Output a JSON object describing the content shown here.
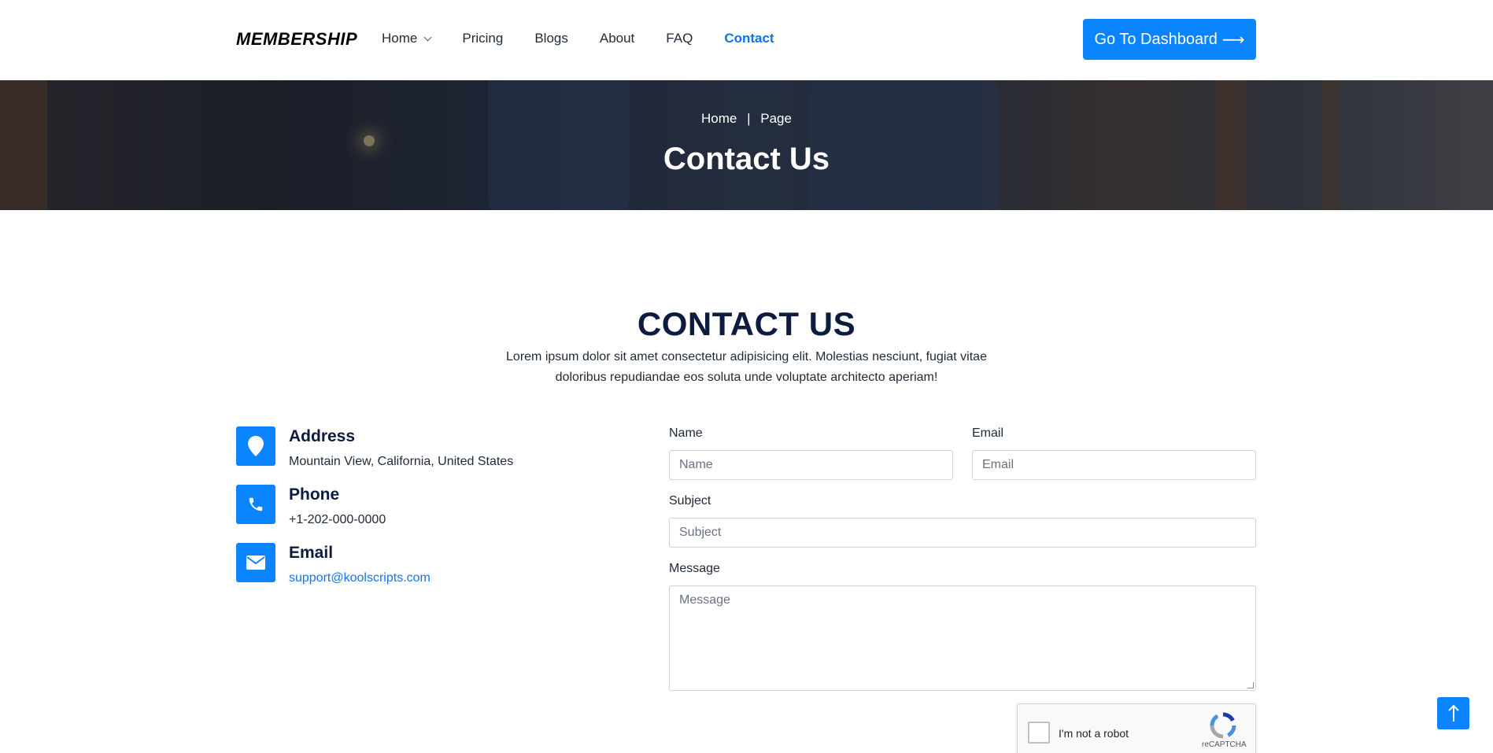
{
  "header": {
    "logo": "MEMBERSHIP",
    "nav": [
      {
        "label": "Home",
        "dropdown": true
      },
      {
        "label": "Pricing"
      },
      {
        "label": "Blogs"
      },
      {
        "label": "About"
      },
      {
        "label": "FAQ"
      },
      {
        "label": "Contact",
        "active": true
      }
    ],
    "dashboard_button": "Go To Dashboard",
    "dashboard_arrow": "⟶",
    "accent_color": "#0a84ff"
  },
  "hero": {
    "breadcrumb": [
      "Home",
      "Page"
    ],
    "breadcrumb_sep": "|",
    "title": "Contact Us"
  },
  "section": {
    "title": "CONTACT US",
    "description": "Lorem ipsum dolor sit amet consectetur adipisicing elit. Molestias nesciunt, fugiat vitae doloribus repudiandae eos soluta unde voluptate architecto aperiam!"
  },
  "contact_info": [
    {
      "icon": "map-pin-icon",
      "heading": "Address",
      "value": "Mountain View, California, United States"
    },
    {
      "icon": "phone-icon",
      "heading": "Phone",
      "value": "+1-202-000-0000"
    },
    {
      "icon": "envelope-icon",
      "heading": "Email",
      "value": "support@koolscripts.com"
    }
  ],
  "form": {
    "name_label": "Name",
    "name_placeholder": "Name",
    "email_label": "Email",
    "email_placeholder": "Email",
    "subject_label": "Subject",
    "subject_placeholder": "Subject",
    "message_label": "Message",
    "message_placeholder": "Message"
  },
  "captcha": {
    "text": "I'm not a robot",
    "brand": "reCAPTCHA"
  },
  "back_to_top_icon": "arrow-up-icon"
}
